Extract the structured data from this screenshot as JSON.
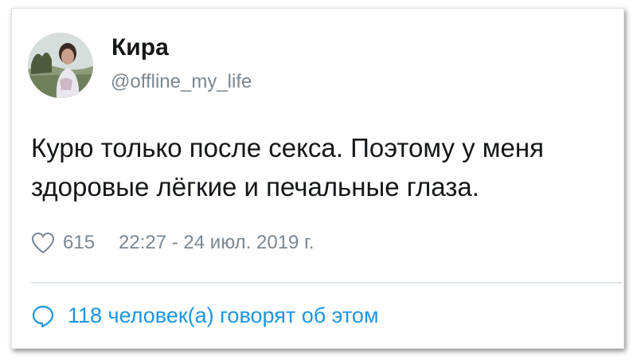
{
  "tweet": {
    "author_name": "Кира",
    "author_handle": "@offline_my_life",
    "text": "Курю только после секса. Поэтому у меня\nздоровые лёгкие и печальные глаза.",
    "likes": "615",
    "timestamp": "22:27 - 24 июл. 2019 г.",
    "replies_label": "118 человек(а) говорят об этом"
  },
  "icons": {
    "like": "heart-icon",
    "replies": "speech-bubble-icon"
  },
  "colors": {
    "text": "#14171a",
    "muted": "#7a8792",
    "accent": "#1b95e0",
    "divider": "#e1e8ed"
  }
}
